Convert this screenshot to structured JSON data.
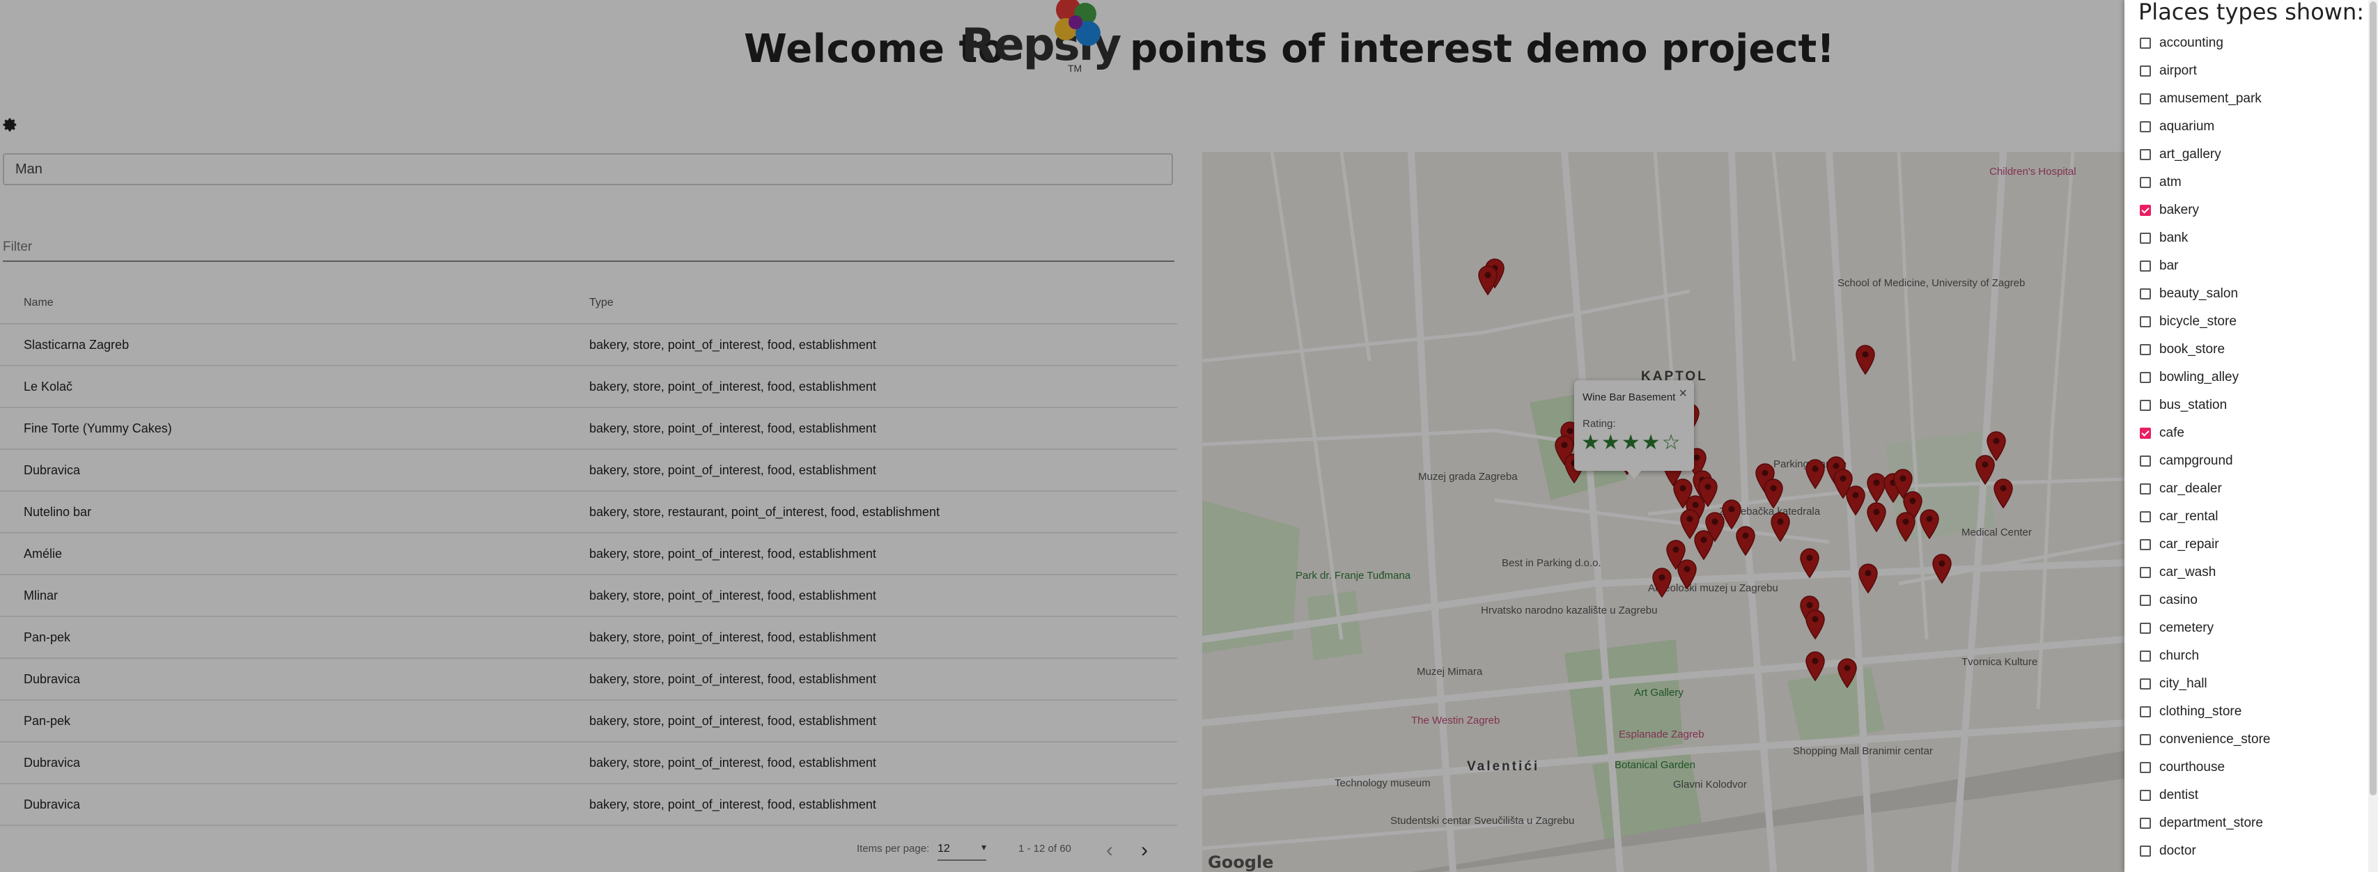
{
  "header": {
    "welcome_prefix": "Welcome to",
    "brand": "Repsly",
    "brand_tm": "TM",
    "welcome_suffix": "points of interest demo project!"
  },
  "search": {
    "value": "Man",
    "placeholder": ""
  },
  "filter": {
    "placeholder": "Filter"
  },
  "table": {
    "columns": [
      "Name",
      "Type"
    ],
    "rows": [
      {
        "name": "Slasticarna Zagreb",
        "type": "bakery, store, point_of_interest, food, establishment"
      },
      {
        "name": "Le Kolač",
        "type": "bakery, store, point_of_interest, food, establishment"
      },
      {
        "name": "Fine Torte (Yummy Cakes)",
        "type": "bakery, store, point_of_interest, food, establishment"
      },
      {
        "name": "Dubravica",
        "type": "bakery, store, point_of_interest, food, establishment"
      },
      {
        "name": "Nutelino bar",
        "type": "bakery, store, restaurant, point_of_interest, food, establishment"
      },
      {
        "name": "Amélie",
        "type": "bakery, store, point_of_interest, food, establishment"
      },
      {
        "name": "Mlinar",
        "type": "bakery, store, point_of_interest, food, establishment"
      },
      {
        "name": "Pan-pek",
        "type": "bakery, store, point_of_interest, food, establishment"
      },
      {
        "name": "Dubravica",
        "type": "bakery, store, point_of_interest, food, establishment"
      },
      {
        "name": "Pan-pek",
        "type": "bakery, store, point_of_interest, food, establishment"
      },
      {
        "name": "Dubravica",
        "type": "bakery, store, point_of_interest, food, establishment"
      },
      {
        "name": "Dubravica",
        "type": "bakery, store, point_of_interest, food, establishment"
      }
    ]
  },
  "paginator": {
    "items_per_page_label": "Items per page:",
    "items_per_page": "12",
    "range": "1 - 12 of 60",
    "prev_icon": "chevron-left-icon",
    "next_icon": "chevron-right-icon"
  },
  "map": {
    "info_window": {
      "title": "Wine Bar Basement",
      "rating_label": "Rating:",
      "stars": "★★★★☆"
    },
    "labels": {
      "kaptol": "KAPTOL",
      "valentici": "Valentići",
      "muzej_grada": "Muzej grada Zagreba",
      "muzej_mimara": "Muzej Mimara",
      "hnk": "Hrvatsko narodno kazalište u Zagrebu",
      "art_gallery": "Art Gallery",
      "esplanade": "Esplanade Zagreb",
      "botanical": "Botanical Garden",
      "technology": "Technology museum",
      "westin": "The Westin Zagreb",
      "shopping": "Shopping Mall Branimir centar",
      "tvornica": "Tvornica Kulture",
      "medical": "Medical Center",
      "childrens": "Children's Hospital",
      "parking": "Parking Garage",
      "best_parking": "Best in Parking d.o.o.",
      "kolodvor": "Glavni Kolodvor",
      "park": "Park dr. Franje Tuđmana",
      "school": "School of Medicine, University of Zagreb",
      "zagrebacka": "Zagrebačka katedrala",
      "studentski": "Studentski centar Sveučilišta u Zagrebu",
      "arheoloski": "Arheološki muzej u Zagrebu",
      "google": "Google"
    }
  },
  "panel": {
    "title": "Places types shown:",
    "types": [
      {
        "label": "accounting",
        "checked": false
      },
      {
        "label": "airport",
        "checked": false
      },
      {
        "label": "amusement_park",
        "checked": false
      },
      {
        "label": "aquarium",
        "checked": false
      },
      {
        "label": "art_gallery",
        "checked": false
      },
      {
        "label": "atm",
        "checked": false
      },
      {
        "label": "bakery",
        "checked": true
      },
      {
        "label": "bank",
        "checked": false
      },
      {
        "label": "bar",
        "checked": false
      },
      {
        "label": "beauty_salon",
        "checked": false
      },
      {
        "label": "bicycle_store",
        "checked": false
      },
      {
        "label": "book_store",
        "checked": false
      },
      {
        "label": "bowling_alley",
        "checked": false
      },
      {
        "label": "bus_station",
        "checked": false
      },
      {
        "label": "cafe",
        "checked": true
      },
      {
        "label": "campground",
        "checked": false
      },
      {
        "label": "car_dealer",
        "checked": false
      },
      {
        "label": "car_rental",
        "checked": false
      },
      {
        "label": "car_repair",
        "checked": false
      },
      {
        "label": "car_wash",
        "checked": false
      },
      {
        "label": "casino",
        "checked": false
      },
      {
        "label": "cemetery",
        "checked": false
      },
      {
        "label": "church",
        "checked": false
      },
      {
        "label": "city_hall",
        "checked": false
      },
      {
        "label": "clothing_store",
        "checked": false
      },
      {
        "label": "convenience_store",
        "checked": false
      },
      {
        "label": "courthouse",
        "checked": false
      },
      {
        "label": "dentist",
        "checked": false
      },
      {
        "label": "department_store",
        "checked": false
      },
      {
        "label": "doctor",
        "checked": false
      }
    ]
  },
  "colors": {
    "accent": "#e91e63",
    "marker": "#b71c1c",
    "stars": "#2e7d32",
    "overlay": "rgba(0,0,0,0.33)"
  }
}
